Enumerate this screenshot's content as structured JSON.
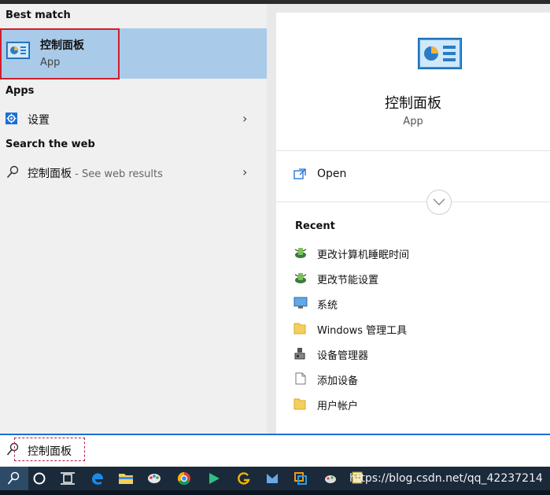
{
  "left_panel": {
    "best_match_heading": "Best match",
    "best_match": {
      "title": "控制面板",
      "subtitle": "App"
    },
    "apps_heading": "Apps",
    "apps": [
      {
        "label": "设置"
      }
    ],
    "web_heading": "Search the web",
    "web_result": {
      "label": "控制面板",
      "suffix": " - See web results"
    }
  },
  "right_panel": {
    "app_name": "控制面板",
    "app_type": "App",
    "open_label": "Open",
    "recent_heading": "Recent",
    "recent_items": [
      {
        "label": "更改计算机睡眠时间",
        "icon": "power-options-icon"
      },
      {
        "label": "更改节能设置",
        "icon": "power-options-icon"
      },
      {
        "label": "系统",
        "icon": "monitor-icon"
      },
      {
        "label": "Windows 管理工具",
        "icon": "folder-icon"
      },
      {
        "label": "设备管理器",
        "icon": "device-manager-icon"
      },
      {
        "label": "添加设备",
        "icon": "document-icon"
      },
      {
        "label": "用户帐户",
        "icon": "folder-icon"
      }
    ]
  },
  "search": {
    "query": "控制面板"
  },
  "taskbar": {
    "items": [
      "search-icon",
      "cortana-icon",
      "task-view-icon",
      "edge-icon",
      "file-explorer-icon",
      "paint-icon",
      "chrome-icon",
      "media-player-icon",
      "g-app-icon",
      "mail-icon",
      "app-icon",
      "tool-icon",
      "notes-icon"
    ],
    "watermark": "https://blog.csdn.net/qq_42237214"
  },
  "colors": {
    "accent": "#1a6ed8",
    "selection": "#a9cbe9",
    "highlight_border": "#d31d2a"
  }
}
